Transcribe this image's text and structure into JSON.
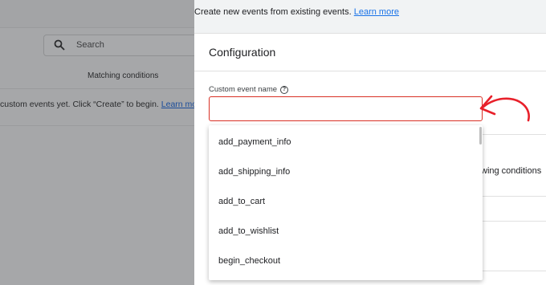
{
  "background": {
    "search": {
      "placeholder": "Search",
      "icon": "search-icon"
    },
    "column_header": "Matching conditions",
    "empty_message": "custom events yet. Click “Create” to begin.",
    "empty_link": "Learn more"
  },
  "panel": {
    "intro_text": "Create new events from existing events.",
    "intro_link": "Learn more",
    "section_title": "Configuration",
    "field": {
      "label": "Custom event name",
      "value": "",
      "help_icon": "help-circle-icon"
    },
    "obscured_text": "wing conditions",
    "dropdown": {
      "options": [
        "add_payment_info",
        "add_shipping_info",
        "add_to_cart",
        "add_to_wishlist",
        "begin_checkout"
      ]
    }
  },
  "colors": {
    "accent_link": "#1a73e8",
    "error_border": "#d93025",
    "annotation_arrow": "#e8202a",
    "overlay": "#a6a7a9"
  }
}
